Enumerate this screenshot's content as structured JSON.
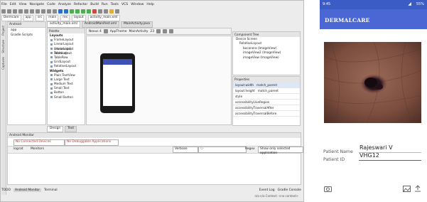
{
  "ide": {
    "menu": [
      "File",
      "Edit",
      "View",
      "Navigate",
      "Code",
      "Analyze",
      "Refactor",
      "Build",
      "Run",
      "Tools",
      "VCS",
      "Window",
      "Help"
    ],
    "breadcrumbs": [
      "Dermcare",
      "app",
      "src",
      "main",
      "res",
      "layout",
      "activity_main.xml"
    ],
    "project": {
      "header": "Android",
      "items": [
        "app",
        "Gradle Scripts"
      ]
    },
    "left_strip": [
      "Project",
      "Structure",
      "Captures"
    ],
    "editor_tabs": [
      "activity_main.xml",
      "AndroidManifest.xml",
      "MainActivity.java"
    ],
    "palette": {
      "header": "Palette",
      "groups": [
        {
          "title": "Layouts",
          "items": [
            "FrameLayout",
            "LinearLayout (Horizontal)",
            "LinearLayout (Vertical)",
            "TableLayout",
            "TableRow",
            "GridLayout",
            "RelativeLayout"
          ]
        },
        {
          "title": "Widgets",
          "items": [
            "Plain TextView",
            "Large Text",
            "Medium Text",
            "Small Text",
            "Button",
            "Small Button"
          ]
        }
      ]
    },
    "design_toolbar": {
      "device": "Nexus 4",
      "theme": "AppTheme",
      "activity": "MainActivity",
      "api": "23"
    },
    "component_tree": {
      "header": "Component Tree",
      "items": [
        "Device Screen",
        "RelativeLayout",
        "bocanera (ImageView)",
        "imageView2 (ImageView)",
        "imageView (ImageView)"
      ],
      "sublabel": "@android:drawable"
    },
    "properties": {
      "header": "Properties",
      "rows": [
        "layout:width",
        "layout:height",
        "style",
        "accessibilityLiveRegion",
        "accessibilityTraversalAfter",
        "accessibilityTraversalBefore"
      ],
      "values": [
        "match_parent",
        "match_parent",
        "",
        "",
        "",
        ""
      ]
    },
    "design_tabs": [
      "Design",
      "Text"
    ],
    "monitor": {
      "header": "Android Monitor",
      "no_devices": "No Connected Devices",
      "no_apps": "No Debuggable Applications",
      "log_tabs": [
        "logcat",
        "Monitors"
      ],
      "log_level": "Verbose",
      "search_placeholder": "Q-",
      "regex_label": "Regex",
      "filter": "Show only selected application"
    },
    "bottom_tabs": [
      "TODO",
      "Android Monitor",
      "Terminal"
    ],
    "bottom_right": [
      "Event Log",
      "Gradle Console"
    ],
    "status": "n/a    n/a    Context: <no context>"
  },
  "phone": {
    "time": "9:45",
    "battery": "55%",
    "app_title": "DERMALCARE",
    "patient_name_label": "Patient Name",
    "patient_name": "Rajeswari V",
    "patient_id_label": "Patient ID",
    "patient_id": "VHG12",
    "colors": {
      "header": "#4a67d3",
      "status": "#3b5cc4",
      "accent": "#e91e63"
    },
    "icons": [
      "camera-icon",
      "gallery-icon",
      "upload-icon"
    ]
  }
}
